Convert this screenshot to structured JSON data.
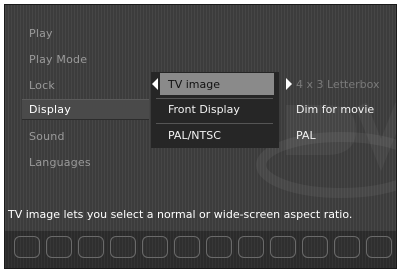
{
  "menu": {
    "items": [
      {
        "label": "Play"
      },
      {
        "label": "Play Mode"
      },
      {
        "label": "Lock"
      },
      {
        "label": "Display"
      },
      {
        "label": "Sound"
      },
      {
        "label": "Languages"
      }
    ],
    "active": "Display"
  },
  "submenu": {
    "items": [
      {
        "label": "TV image",
        "value": "4 x 3 Letterbox",
        "selected": true
      },
      {
        "label": "Front Display",
        "value": "Dim for movie",
        "selected": false
      },
      {
        "label": "PAL/NTSC",
        "value": "PAL",
        "selected": false
      }
    ]
  },
  "help_text": "TV image lets you select a normal or wide-screen aspect ratio.",
  "colors": {
    "panel_bg": "#3c3c3c",
    "selection_bg": "#8a8a8a",
    "text_primary": "#ffffff",
    "text_muted": "#9a9a9a"
  },
  "icons": {
    "left_arrow": "triangle-left-icon",
    "right_arrow": "triangle-right-icon",
    "logo": "dvd-logo-icon"
  }
}
